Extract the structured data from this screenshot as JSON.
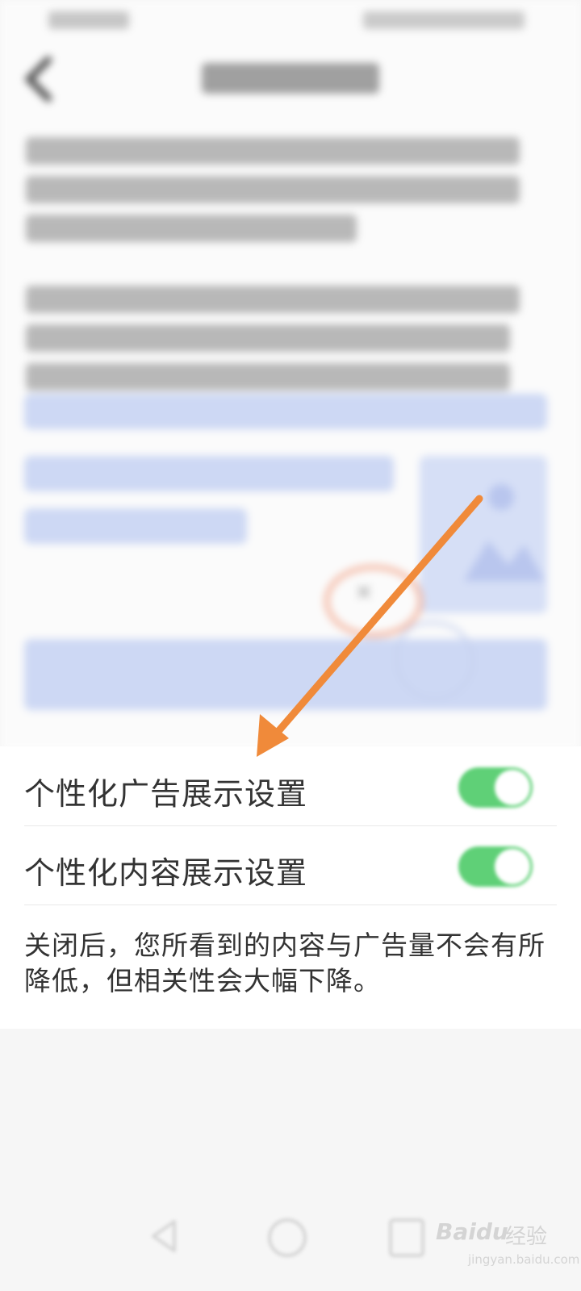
{
  "settings": {
    "items": [
      {
        "label": "个性化广告展示设置",
        "enabled": true
      },
      {
        "label": "个性化内容展示设置",
        "enabled": true
      }
    ],
    "note": "关闭后，您所看到的内容与广告量不会有所降低，但相关性会大幅下降。"
  },
  "colors": {
    "toggle_on": "#5fd077",
    "annotation_arrow": "#f08a3a",
    "placeholder": "#cdd8f4"
  },
  "watermark": {
    "brand": "Baidu",
    "product": "经验",
    "url": "jingyan.baidu.com"
  }
}
